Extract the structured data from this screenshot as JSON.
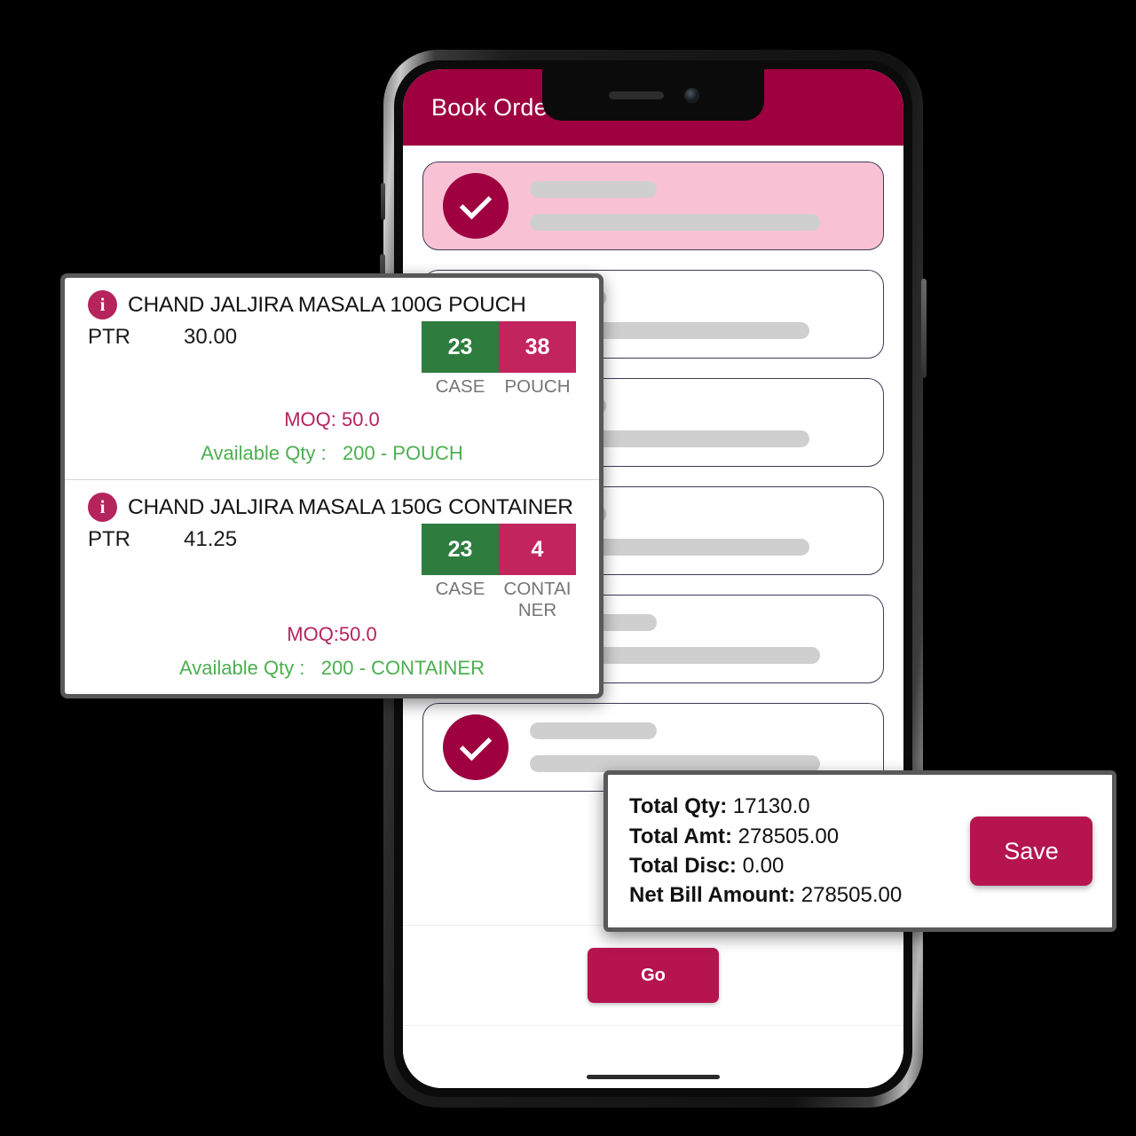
{
  "app": {
    "title": "Book Order",
    "accent_crimson": "#9e0040",
    "accent_pink": "#c2255c",
    "accent_green": "#2e7d3e",
    "selected_card_bg": "#f9c2d4"
  },
  "order_list": {
    "items": [
      {
        "checked": true,
        "placeholder_short": "",
        "placeholder_long": ""
      },
      {
        "checked": false,
        "placeholder_short": "",
        "placeholder_long": ""
      },
      {
        "checked": false,
        "placeholder_short": "",
        "placeholder_long": ""
      },
      {
        "checked": false,
        "placeholder_short": "",
        "placeholder_long": ""
      },
      {
        "checked": true,
        "placeholder_short": "",
        "placeholder_long": ""
      },
      {
        "checked": true,
        "placeholder_short": "",
        "placeholder_long": ""
      }
    ],
    "go_label": "Go"
  },
  "product_popup": {
    "products": [
      {
        "info_glyph": "i",
        "name": "CHAND JALJIRA MASALA 100G POUCH",
        "ptr_label": "PTR",
        "ptr_value": "30.00",
        "case_qty": "23",
        "case_caption": "CASE",
        "unit_qty": "38",
        "unit_caption": "POUCH",
        "moq": "MOQ: 50.0",
        "available": "Available Qty :   200 - POUCH"
      },
      {
        "info_glyph": "i",
        "name": "CHAND JALJIRA MASALA 150G CONTAINER",
        "ptr_label": "PTR",
        "ptr_value": "41.25",
        "case_qty": "23",
        "case_caption": "CASE",
        "unit_qty": "4",
        "unit_caption": "CONTAINER",
        "moq": "MOQ:50.0",
        "available": "Available Qty :   200 - CONTAINER"
      }
    ]
  },
  "totals_popup": {
    "rows": [
      {
        "key": "Total Qty:",
        "value": "17130.0"
      },
      {
        "key": "Total Amt:",
        "value": "278505.00"
      },
      {
        "key": "Total Disc:",
        "value": "0.00"
      },
      {
        "key": "Net Bill Amount:",
        "value": "278505.00"
      }
    ],
    "save_label": "Save"
  }
}
